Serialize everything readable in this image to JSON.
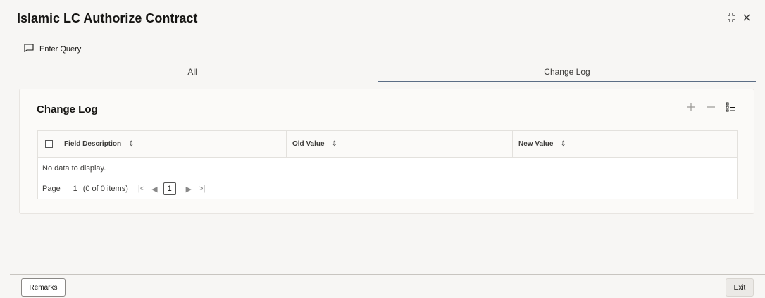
{
  "window": {
    "title": "Islamic LC Authorize Contract"
  },
  "toolbar": {
    "enter_query_label": "Enter Query"
  },
  "tabs": [
    {
      "label": "All"
    },
    {
      "label": "Change Log"
    }
  ],
  "change_log": {
    "section_title": "Change Log",
    "columns": [
      {
        "label": "Field Description"
      },
      {
        "label": "Old Value"
      },
      {
        "label": "New Value"
      }
    ],
    "empty_message": "No data to display.",
    "pager": {
      "page_label": "Page",
      "page_value": "1",
      "items_summary": "(0 of 0 items)",
      "current_page": "1"
    }
  },
  "footer": {
    "remarks_label": "Remarks",
    "exit_label": "Exit"
  },
  "colors": {
    "accent_underline": "#5b6d85",
    "background": "#f7f6f4"
  }
}
